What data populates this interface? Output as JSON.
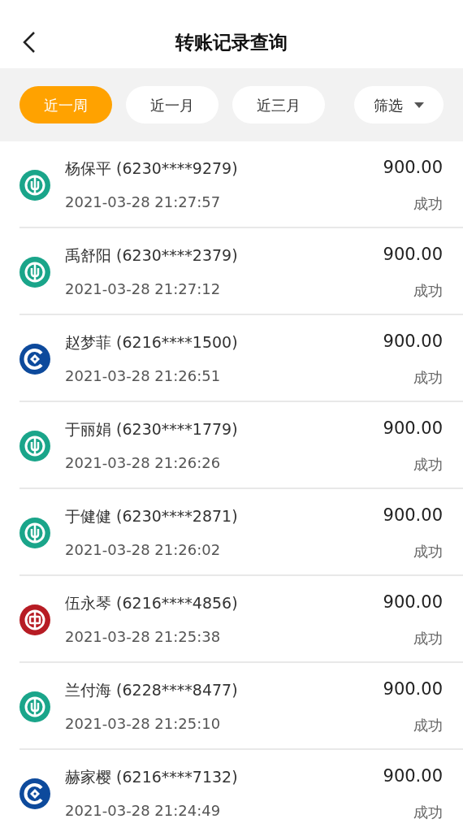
{
  "header": {
    "title": "转账记录查询"
  },
  "filters": [
    {
      "label": "近一周",
      "selected": true
    },
    {
      "label": "近一月",
      "selected": false
    },
    {
      "label": "近三月",
      "selected": false
    }
  ],
  "filter_menu": {
    "label": "筛选"
  },
  "records": [
    {
      "kind": "wheat",
      "name": "杨保平 (6230****9279)",
      "time": "2021-03-28 21:27:57",
      "amount": "900.00",
      "status": "成功"
    },
    {
      "kind": "wheat",
      "name": "禹舒阳 (6230****2379)",
      "time": "2021-03-28 21:27:12",
      "amount": "900.00",
      "status": "成功"
    },
    {
      "kind": "diamond",
      "name": "赵梦菲 (6216****1500)",
      "time": "2021-03-28 21:26:51",
      "amount": "900.00",
      "status": "成功"
    },
    {
      "kind": "wheat",
      "name": "于丽娟 (6230****1779)",
      "time": "2021-03-28 21:26:26",
      "amount": "900.00",
      "status": "成功"
    },
    {
      "kind": "wheat",
      "name": "于健健 (6230****2871)",
      "time": "2021-03-28 21:26:02",
      "amount": "900.00",
      "status": "成功"
    },
    {
      "kind": "coin",
      "name": "伍永琴 (6216****4856)",
      "time": "2021-03-28 21:25:38",
      "amount": "900.00",
      "status": "成功"
    },
    {
      "kind": "wheat",
      "name": "兰付海 (6228****8477)",
      "time": "2021-03-28 21:25:10",
      "amount": "900.00",
      "status": "成功"
    },
    {
      "kind": "diamond",
      "name": "赫家樱 (6216****7132)",
      "time": "2021-03-28 21:24:49",
      "amount": "900.00",
      "status": "成功"
    }
  ]
}
